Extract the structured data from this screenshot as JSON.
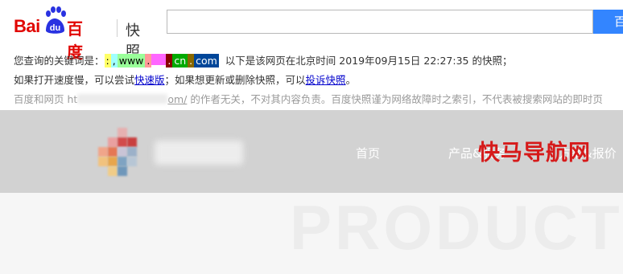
{
  "header": {
    "logo_bai": "Bai",
    "logo_du": "du",
    "logo_baidu_cn": "百度",
    "logo_kuaizhao": "快照",
    "search_value": "",
    "search_button": "百"
  },
  "info": {
    "query_prefix": "您查询的关键词是：",
    "keywords": [
      ":",
      ",",
      "www",
      ".",
      "",
      ".",
      "cn",
      ".",
      "com"
    ],
    "query_suffix": "以下是该网页在北京时间 2019年09月15日 22:27:35 的快照；",
    "slow_prefix": "如果打开速度慢，可以尝试",
    "fast_link": "快速版",
    "slow_middle": "；如果想更新或删除快照，可以",
    "complain_link": "投诉快照",
    "slow_suffix": "。",
    "disclaimer_prefix": "百度和网页 ht",
    "disclaimer_url_tail": "om/",
    "disclaimer_suffix": " 的作者无关，不对其内容负责。百度快照谨为网络故障时之索引，不代表被搜索网站的即时页"
  },
  "snapshot": {
    "nav": [
      "首页",
      "产品&服务",
      "方案&报价"
    ],
    "watermark": "PRODUCT",
    "site_badge": "快马导航网"
  },
  "colors": {
    "baidu_red": "#e10602",
    "paw_blue": "#2932e1",
    "search_blue": "#3385ff",
    "link_blue": "#0000cc",
    "nav_gray": "#d2d2d2",
    "badge_red": "#d61a1a"
  }
}
